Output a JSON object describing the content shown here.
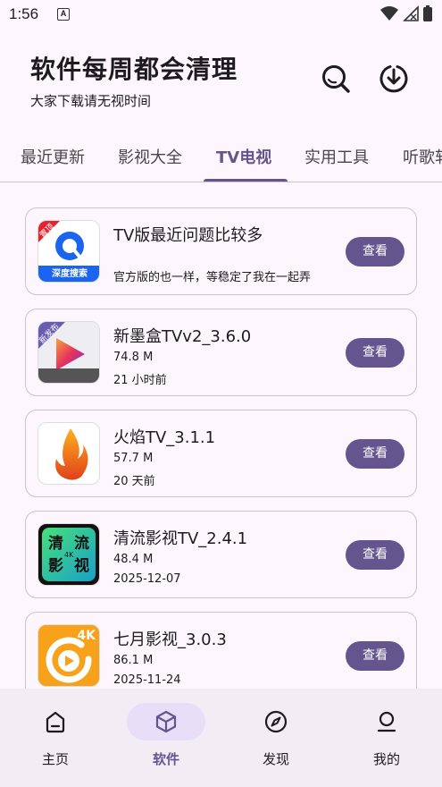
{
  "status": {
    "time": "1:56",
    "notif": "A"
  },
  "header": {
    "title": "软件每周都会清理",
    "subtitle": "大家下载请无视时间"
  },
  "tabs": [
    {
      "label": "最近更新"
    },
    {
      "label": "影视大全"
    },
    {
      "label": "TV电视"
    },
    {
      "label": "实用工具"
    },
    {
      "label": "听歌软件"
    }
  ],
  "apps": [
    {
      "title": "TV版最近问题比较多",
      "line1": "官方版的也一样，等稳定了我在一起弄",
      "line2": "",
      "badge": "置顶",
      "thumb_text": "深度搜索",
      "button": "查看"
    },
    {
      "title": "新墨盒TVv2_3.6.0",
      "line1": "74.8 M",
      "line2": "21 小时前",
      "badge": "新发布",
      "thumb_text": "",
      "button": "查看"
    },
    {
      "title": "火焰TV_3.1.1",
      "line1": "57.7 M",
      "line2": "20 天前",
      "badge": "",
      "thumb_text": "",
      "button": "查看"
    },
    {
      "title": "清流影视TV_2.4.1",
      "line1": "48.4 M",
      "line2": "2025-12-07",
      "badge": "",
      "thumb_text": "清 流 影 视",
      "thumb_sub": "4K",
      "button": "查看"
    },
    {
      "title": "七月影视_3.0.3",
      "line1": "86.1 M",
      "line2": "2025-11-24",
      "badge": "",
      "thumb_text": "4K",
      "button": "查看"
    }
  ],
  "nav": [
    {
      "label": "主页",
      "icon": "home-icon"
    },
    {
      "label": "软件",
      "icon": "cube-icon"
    },
    {
      "label": "发现",
      "icon": "compass-icon"
    },
    {
      "label": "我的",
      "icon": "person-icon"
    }
  ],
  "colors": {
    "accent": "#65558f",
    "pill": "#e8def8",
    "bg": "#fdf7fd"
  }
}
